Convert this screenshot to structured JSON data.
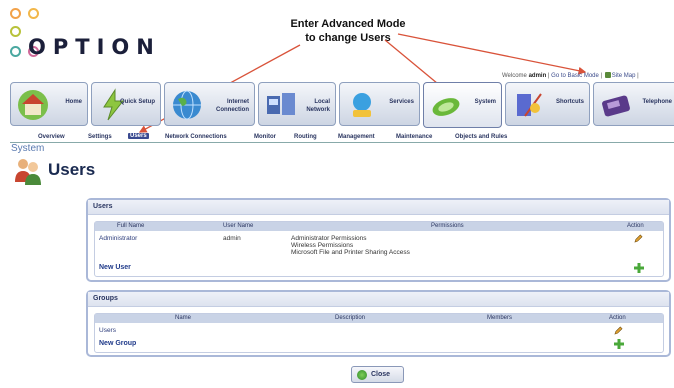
{
  "logo": {
    "text": "OPTION"
  },
  "annotation": {
    "line1": "Enter Advanced Mode",
    "line2": "to change Users"
  },
  "welcome": {
    "prefix": "Welcome",
    "user": "admin",
    "basic_mode": "Go to Basic Mode",
    "site_map": "Site Map"
  },
  "nav": {
    "tiles": [
      {
        "label": "Home"
      },
      {
        "label": "Quick Setup"
      },
      {
        "label": "Internet Connection"
      },
      {
        "label": "Local Network"
      },
      {
        "label": "Services"
      },
      {
        "label": "System"
      },
      {
        "label": "Shortcuts"
      },
      {
        "label": "Telephone"
      }
    ]
  },
  "subnav": {
    "items": [
      "Overview",
      "Settings",
      "Users",
      "Network Connections",
      "Monitor",
      "Routing",
      "Management",
      "Maintenance",
      "Objects and Rules"
    ],
    "selected": "Users"
  },
  "breadcrumb": "System",
  "page_title": "Users",
  "users_panel": {
    "title": "Users",
    "columns": [
      "Full Name",
      "User Name",
      "Permissions",
      "Action"
    ],
    "rows": [
      {
        "full_name": "Administrator",
        "user_name": "admin",
        "permissions": [
          "Administrator Permissions",
          "Wireless Permissions",
          "Microsoft File and Printer Sharing Access"
        ]
      }
    ],
    "new_label": "New User"
  },
  "groups_panel": {
    "title": "Groups",
    "columns": [
      "Name",
      "Description",
      "Members",
      "Action"
    ],
    "rows": [
      {
        "name": "Users",
        "description": "",
        "members": ""
      }
    ],
    "new_label": "New Group"
  },
  "close_label": "Close",
  "colors": {
    "accent": "#3a4a90",
    "link": "#1f3a8a",
    "arrow": "#d9533a",
    "panel_border": "#aab8d8"
  }
}
